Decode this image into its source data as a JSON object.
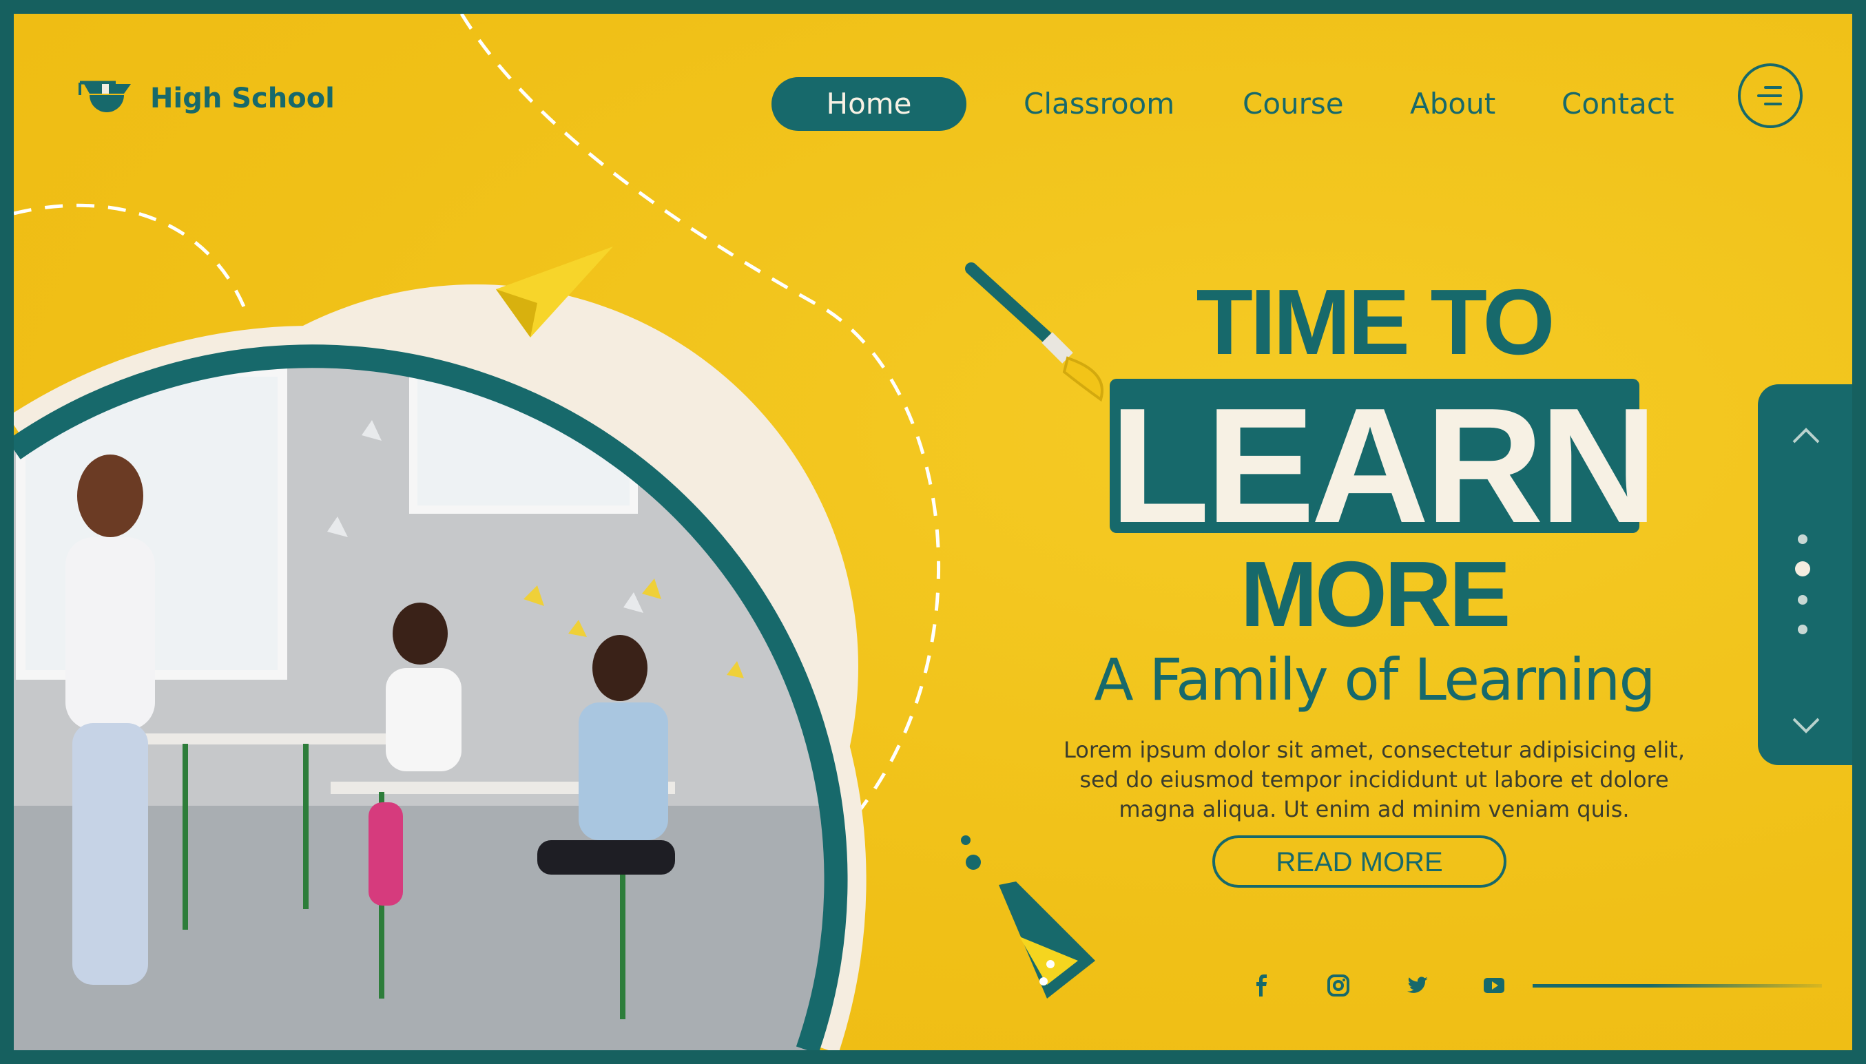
{
  "logo": {
    "text": "High School",
    "icon": "graduation-cap-icon"
  },
  "nav": {
    "items": [
      {
        "label": "Home",
        "active": true
      },
      {
        "label": "Classroom"
      },
      {
        "label": "Course"
      },
      {
        "label": "About"
      },
      {
        "label": "Contact"
      }
    ],
    "menu_icon": "menu-icon"
  },
  "hero": {
    "line1": "TIME TO",
    "line2": "LEARN",
    "line3": "MORE",
    "subtitle": "A Family of Learning",
    "paragraph": [
      "Lorem ipsum dolor sit amet, consectetur adipisicing elit,",
      "sed do eiusmod tempor incididunt ut labore et dolore",
      "magna aliqua. Ut enim ad minim veniam quis."
    ],
    "cta": "READ MORE"
  },
  "social": [
    "facebook-icon",
    "instagram-icon",
    "twitter-icon",
    "youtube-icon"
  ],
  "slider": {
    "dots": 4,
    "active_index": 1
  },
  "colors": {
    "primary": "#17696b",
    "background": "#f2c41a",
    "cream": "#f5ede0"
  }
}
